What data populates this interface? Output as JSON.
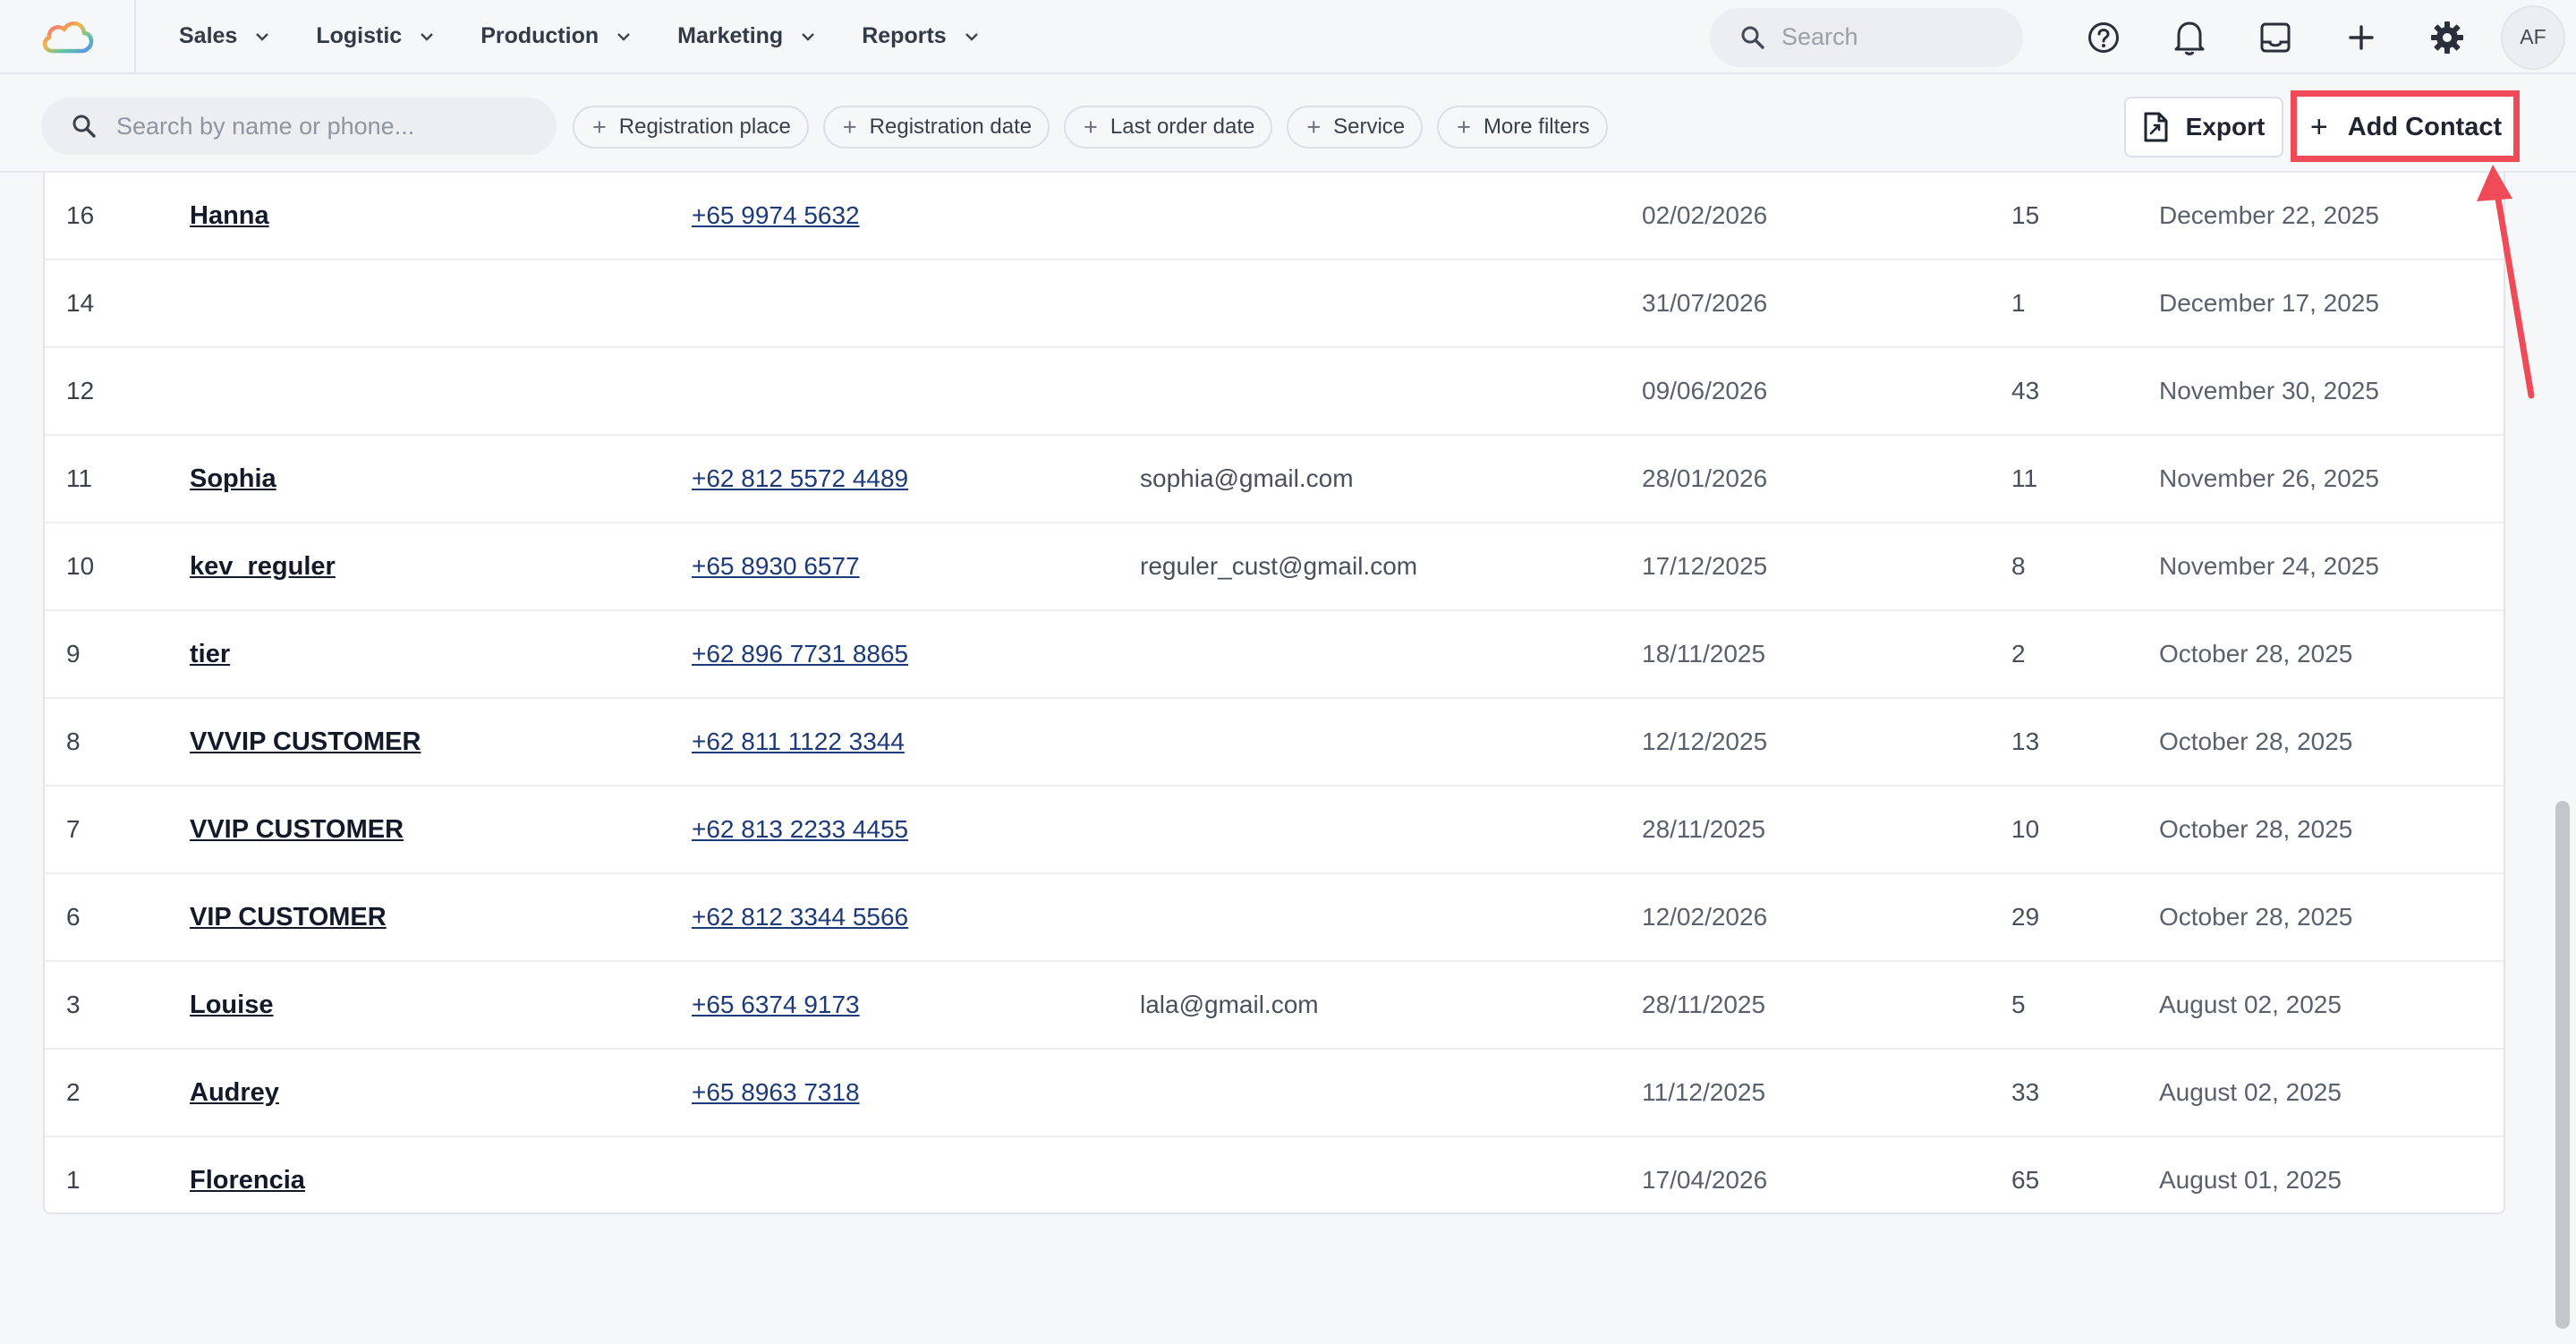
{
  "nav": {
    "items": [
      {
        "label": "Sales"
      },
      {
        "label": "Logistic"
      },
      {
        "label": "Production"
      },
      {
        "label": "Marketing"
      },
      {
        "label": "Reports"
      }
    ],
    "search_placeholder": "Search",
    "user_initials": "AF"
  },
  "filters": {
    "search_placeholder": "Search by name or phone...",
    "chips": [
      {
        "label": "Registration place"
      },
      {
        "label": "Registration date"
      },
      {
        "label": "Last order date"
      },
      {
        "label": "Service"
      },
      {
        "label": "More filters"
      }
    ],
    "export_label": "Export",
    "add_contact_label": "Add Contact"
  },
  "annotation": {
    "color": "#ef4a58"
  },
  "contacts": [
    {
      "id": "16",
      "name": "Hanna",
      "phone": "+65 9974 5632",
      "email": "",
      "date": "02/02/2026",
      "count": "15",
      "registered": "December 22, 2025"
    },
    {
      "id": "14",
      "name": "",
      "phone": "",
      "email": "",
      "date": "31/07/2026",
      "count": "1",
      "registered": "December 17, 2025"
    },
    {
      "id": "12",
      "name": "",
      "phone": "",
      "email": "",
      "date": "09/06/2026",
      "count": "43",
      "registered": "November 30, 2025"
    },
    {
      "id": "11",
      "name": "Sophia",
      "phone": "+62 812 5572 4489",
      "email": "sophia@gmail.com",
      "date": "28/01/2026",
      "count": "11",
      "registered": "November 26, 2025"
    },
    {
      "id": "10",
      "name": "kev_reguler",
      "phone": "+65 8930 6577",
      "email": "reguler_cust@gmail.com",
      "date": "17/12/2025",
      "count": "8",
      "registered": "November 24, 2025"
    },
    {
      "id": "9",
      "name": "tier",
      "phone": "+62 896 7731 8865",
      "email": "",
      "date": "18/11/2025",
      "count": "2",
      "registered": "October 28, 2025"
    },
    {
      "id": "8",
      "name": "VVVIP CUSTOMER",
      "phone": "+62 811 1122 3344",
      "email": "",
      "date": "12/12/2025",
      "count": "13",
      "registered": "October 28, 2025"
    },
    {
      "id": "7",
      "name": "VVIP CUSTOMER",
      "phone": "+62 813 2233 4455",
      "email": "",
      "date": "28/11/2025",
      "count": "10",
      "registered": "October 28, 2025"
    },
    {
      "id": "6",
      "name": "VIP CUSTOMER",
      "phone": "+62 812 3344 5566",
      "email": "",
      "date": "12/02/2026",
      "count": "29",
      "registered": "October 28, 2025"
    },
    {
      "id": "3",
      "name": "Louise",
      "phone": "+65 6374 9173",
      "email": "lala@gmail.com",
      "date": "28/11/2025",
      "count": "5",
      "registered": "August 02, 2025"
    },
    {
      "id": "2",
      "name": "Audrey",
      "phone": "+65 8963 7318",
      "email": "",
      "date": "11/12/2025",
      "count": "33",
      "registered": "August 02, 2025"
    },
    {
      "id": "1",
      "name": "Florencia",
      "phone": "",
      "email": "",
      "date": "17/04/2026",
      "count": "65",
      "registered": "August 01, 2025"
    }
  ]
}
